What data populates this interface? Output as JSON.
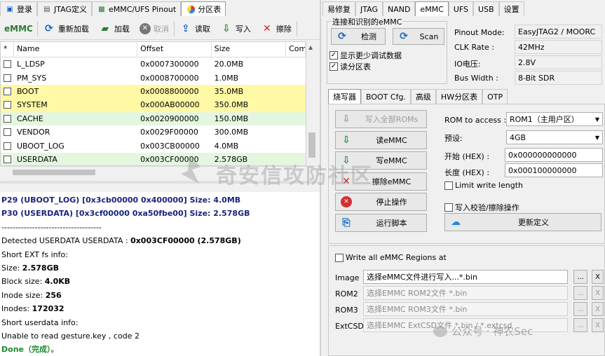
{
  "left_tabs": [
    {
      "label": "登录",
      "icon": "login-icon"
    },
    {
      "label": "JTAG定义",
      "icon": "jtag-icon"
    },
    {
      "label": "eMMC/UFS Pinout",
      "icon": "pinout-icon"
    },
    {
      "label": "分区表",
      "icon": "pie-chart-icon"
    }
  ],
  "toolbar": {
    "emmc_label": "eMMC",
    "reload": "重新加载",
    "load": "加载",
    "cancel": "取消",
    "read": "读取",
    "write": "写入",
    "erase": "擦除"
  },
  "table": {
    "headers": [
      "*",
      "Name",
      "Offset",
      "Size",
      "Com"
    ],
    "rows": [
      {
        "name": "L_LDSP",
        "offset": "0x0007300000",
        "size": "20.0MB",
        "hl": ""
      },
      {
        "name": "PM_SYS",
        "offset": "0x0008700000",
        "size": "1.0MB",
        "hl": ""
      },
      {
        "name": "BOOT",
        "offset": "0x0008800000",
        "size": "35.0MB",
        "hl": "#fff9a6"
      },
      {
        "name": "SYSTEM",
        "offset": "0x000AB00000",
        "size": "350.0MB",
        "hl": "#fff9a6"
      },
      {
        "name": "CACHE",
        "offset": "0x0020900000",
        "size": "150.0MB",
        "hl": "#e3f7df"
      },
      {
        "name": "VENDOR",
        "offset": "0x0029F00000",
        "size": "300.0MB",
        "hl": ""
      },
      {
        "name": "UBOOT_LOG",
        "offset": "0x003CB00000",
        "size": "4.0MB",
        "hl": ""
      },
      {
        "name": "USERDATA",
        "offset": "0x003CF00000",
        "size": "2.578GB",
        "hl": "#e3f7df"
      }
    ]
  },
  "log": [
    {
      "parts": [
        {
          "t": "P29 (UBOOT_LOG) [0x3cb00000 0x400000] ",
          "c": "#1a237e",
          "b": true
        },
        {
          "t": "Size: 4.0MB",
          "c": "#1a237e",
          "b": true
        }
      ]
    },
    {
      "parts": [
        {
          "t": "P30 (USERDATA) [0x3cf00000 0xa50fbe00] ",
          "c": "#1a237e",
          "b": true
        },
        {
          "t": "Size: 2.578GB",
          "c": "#1a237e",
          "b": true
        }
      ]
    },
    {
      "parts": [
        {
          "t": "------------------------------------",
          "c": "#000",
          "b": false
        }
      ]
    },
    {
      "parts": [
        {
          "t": "Detected USERDATA USERDATA : ",
          "c": "#000",
          "b": false
        },
        {
          "t": "0x003CF00000 (2.578GB)",
          "c": "#000",
          "b": true
        }
      ]
    },
    {
      "parts": [
        {
          "t": "Short EXT fs info:",
          "c": "#000",
          "b": false
        }
      ]
    },
    {
      "parts": [
        {
          "t": "Size: ",
          "c": "#000",
          "b": false
        },
        {
          "t": "2.578GB",
          "c": "#000",
          "b": true
        }
      ]
    },
    {
      "parts": [
        {
          "t": "Block size: ",
          "c": "#000",
          "b": false
        },
        {
          "t": "4.0KB",
          "c": "#000",
          "b": true
        }
      ]
    },
    {
      "parts": [
        {
          "t": "Inode size: ",
          "c": "#000",
          "b": false
        },
        {
          "t": "256",
          "c": "#000",
          "b": true
        }
      ]
    },
    {
      "parts": [
        {
          "t": "Inodes: ",
          "c": "#000",
          "b": false
        },
        {
          "t": "172032",
          "c": "#000",
          "b": true
        }
      ]
    },
    {
      "parts": [
        {
          "t": "Short userdata info:",
          "c": "#000",
          "b": false
        }
      ]
    },
    {
      "parts": [
        {
          "t": "Unable to read gesture.key , code 2",
          "c": "#000",
          "b": false
        }
      ]
    },
    {
      "parts": [
        {
          "t": "Done（完成）",
          "c": "#1b8a2e",
          "b": true
        },
        {
          "t": "。",
          "c": "#000",
          "b": false
        }
      ]
    }
  ],
  "right_tabs": [
    "易修复",
    "JTAG",
    "NAND",
    "eMMC",
    "UFS",
    "USB",
    "设置"
  ],
  "right_active_tab": "eMMC",
  "conn": {
    "group_title": "连接和识别的eMMC",
    "detect_label": "检测",
    "scan_label": "Scan",
    "show_less_debug": "显示更少调试数据",
    "read_partition": "读分区表",
    "info": [
      {
        "label": "Pinout Mode:",
        "value": "EasyJTAG2 / MOORC"
      },
      {
        "label": "CLK Rate :",
        "value": "42MHz"
      },
      {
        "label": "IO电压:",
        "value": "2.8V"
      },
      {
        "label": "Bus Width :",
        "value": "8-Bit SDR"
      }
    ]
  },
  "inner_tabs": [
    "烧写器",
    "BOOT Cfg.",
    "高级",
    "HW分区表",
    "OTP"
  ],
  "actions": [
    {
      "label": "写入全部ROMs",
      "icon": "download-arrow-icon",
      "color": "#9a9a9a",
      "disabled": true
    },
    {
      "label": "读eMMC",
      "icon": "read-arrow-icon",
      "color": "#2e8b3a",
      "disabled": false
    },
    {
      "label": "写eMMC",
      "icon": "write-arrow-icon",
      "color": "#2e8b3a",
      "disabled": false
    },
    {
      "label": "擦除eMMC",
      "icon": "erase-x-icon",
      "color": "#c62828",
      "disabled": false
    },
    {
      "label": "停止操作",
      "icon": "stop-icon",
      "color": "#d32f2f",
      "disabled": false
    },
    {
      "label": "运行脚本",
      "icon": "script-icon",
      "color": "#1565c0",
      "disabled": false
    }
  ],
  "settings": {
    "rom_access_label": "ROM to access :",
    "rom_access_value": "ROM1（主用户区）",
    "preset_label": "预设:",
    "preset_value": "4GB",
    "start_label": "开始 (HEX) :",
    "start_value": "0x000000000000",
    "length_label": "长度 (HEX) :",
    "length_value": "0x000100000000",
    "limit_write": "Limit write length",
    "write_verify": "写入校验/擦除操作",
    "update_def": "更新定义"
  },
  "regions": {
    "write_all": "Write all eMMC Regions at",
    "rows": [
      {
        "label": "Image",
        "value": "选择eMMC文件进行写入...*.bin",
        "enabled": true
      },
      {
        "label": "ROM2",
        "value": "选择EMMC ROM2文件 *.bin",
        "enabled": false
      },
      {
        "label": "ROM3",
        "value": "选择EMMC ROM3文件 *.bin",
        "enabled": false
      },
      {
        "label": "ExtCSD",
        "value": "选择EMMC ExtCSD文件 *.bin / *.extcsd",
        "enabled": false
      }
    ],
    "browse": "...",
    "clear": "X"
  },
  "watermark": "奇安信攻防社区",
  "footer_mark": "公众号 · 神农Sec"
}
